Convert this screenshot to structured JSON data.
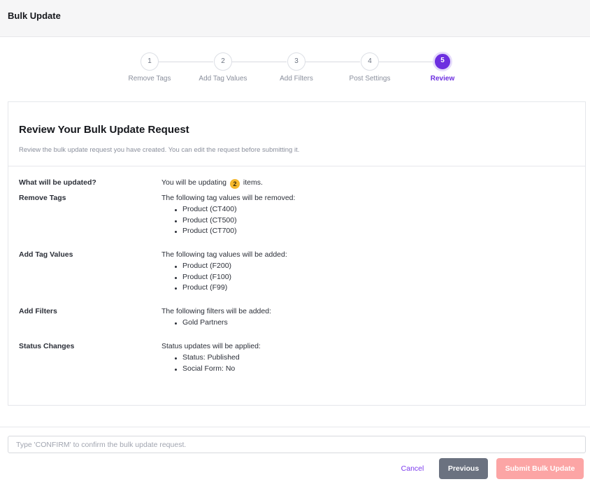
{
  "header": {
    "title": "Bulk Update"
  },
  "stepper": {
    "steps": [
      {
        "number": "1",
        "label": "Remove Tags"
      },
      {
        "number": "2",
        "label": "Add Tag Values"
      },
      {
        "number": "3",
        "label": "Add Filters"
      },
      {
        "number": "4",
        "label": "Post Settings"
      },
      {
        "number": "5",
        "label": "Review"
      }
    ],
    "active_step": 5
  },
  "review": {
    "title": "Review Your Bulk Update Request",
    "subtitle": "Review the bulk update request you have created. You can edit the request before submitting it.",
    "summary": {
      "label": "What will be updated?",
      "prefix": "You will be updating",
      "count": "2",
      "suffix": "items."
    },
    "remove_tags": {
      "label": "Remove Tags",
      "intro": "The following tag values will be removed:",
      "items": [
        "Product (CT400)",
        "Product (CT500)",
        "Product (CT700)"
      ]
    },
    "add_tag_values": {
      "label": "Add Tag Values",
      "intro": "The following tag values will be added:",
      "items": [
        "Product (F200)",
        "Product (F100)",
        "Product (F99)"
      ]
    },
    "add_filters": {
      "label": "Add Filters",
      "intro": "The following filters will be added:",
      "items": [
        "Gold Partners"
      ]
    },
    "status_changes": {
      "label": "Status Changes",
      "intro": "Status updates will be applied:",
      "items": [
        "Status: Published",
        "Social Form: No"
      ]
    }
  },
  "confirm": {
    "placeholder": "Type 'CONFIRM' to confirm the bulk update request.",
    "value": ""
  },
  "actions": {
    "cancel": "Cancel",
    "previous": "Previous",
    "submit": "Submit Bulk Update"
  },
  "colors": {
    "accent": "#6d2fe0",
    "badge": "#f5b82e",
    "previous_button": "#6b7280",
    "submit_button_disabled": "#fca5a5",
    "cancel_link": "#7c3aed"
  }
}
